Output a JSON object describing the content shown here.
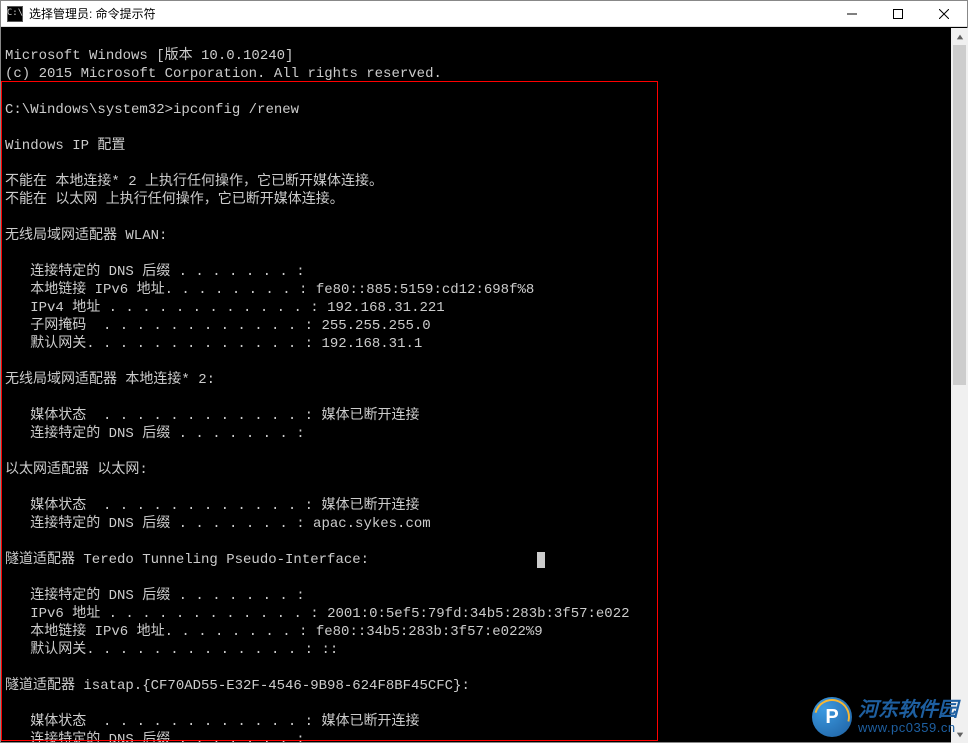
{
  "titlebar": {
    "icon_text": "C:\\",
    "title": "选择管理员: 命令提示符",
    "minimize": "—",
    "close": "×"
  },
  "console": {
    "header": {
      "line1": "Microsoft Windows [版本 10.0.10240]",
      "line2": "(c) 2015 Microsoft Corporation. All rights reserved."
    },
    "prompt": "C:\\Windows\\system32>",
    "command": "ipconfig /renew",
    "ip_config_title": "Windows IP 配置",
    "errors": {
      "local2": "不能在 本地连接* 2 上执行任何操作，它已断开媒体连接。",
      "ethernet": "不能在 以太网 上执行任何操作，它已断开媒体连接。"
    },
    "wlan": {
      "header": "无线局域网适配器 WLAN:",
      "dns_suffix_label": "   连接特定的 DNS 后缀 . . . . . . . :",
      "link_local_label": "   本地链接 IPv6 地址. . . . . . . . : ",
      "link_local_value": "fe80::885:5159:cd12:698f%8",
      "ipv4_label": "   IPv4 地址 . . . . . . . . . . . . : ",
      "ipv4_value": "192.168.31.221",
      "subnet_label": "   子网掩码  . . . . . . . . . . . . : ",
      "subnet_value": "255.255.255.0",
      "gateway_label": "   默认网关. . . . . . . . . . . . . : ",
      "gateway_value": "192.168.31.1"
    },
    "local2": {
      "header": "无线局域网适配器 本地连接* 2:",
      "media_label": "   媒体状态  . . . . . . . . . . . . : ",
      "media_value": "媒体已断开连接",
      "dns_suffix_label": "   连接特定的 DNS 后缀 . . . . . . . :"
    },
    "ethernet": {
      "header": "以太网适配器 以太网:",
      "media_label": "   媒体状态  . . . . . . . . . . . . : ",
      "media_value": "媒体已断开连接",
      "dns_suffix_label": "   连接特定的 DNS 后缀 . . . . . . . : ",
      "dns_suffix_value": "apac.sykes.com"
    },
    "teredo": {
      "header": "隧道适配器 Teredo Tunneling Pseudo-Interface:",
      "dns_suffix_label": "   连接特定的 DNS 后缀 . . . . . . . :",
      "ipv6_label": "   IPv6 地址 . . . . . . . . . . . . : ",
      "ipv6_value": "2001:0:5ef5:79fd:34b5:283b:3f57:e022",
      "link_local_label": "   本地链接 IPv6 地址. . . . . . . . : ",
      "link_local_value": "fe80::34b5:283b:3f57:e022%9",
      "gateway_label": "   默认网关. . . . . . . . . . . . . : ",
      "gateway_value": "::"
    },
    "isatap": {
      "header": "隧道适配器 isatap.{CF70AD55-E32F-4546-9B98-624F8BF45CFC}:",
      "media_label": "   媒体状态  . . . . . . . . . . . . : ",
      "media_value": "媒体已断开连接",
      "dns_suffix_label": "   连接特定的 DNS 后缀 . . . . . . . :"
    }
  },
  "watermark": {
    "icon_letter": "P",
    "cn": "河东软件园",
    "url": "www.pc0359.cn"
  }
}
